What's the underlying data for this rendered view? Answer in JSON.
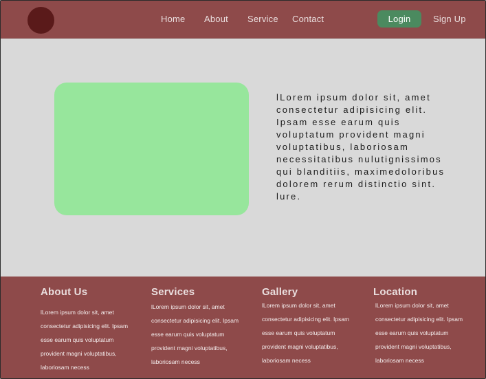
{
  "nav": {
    "home": "Home",
    "about": "About",
    "service": "Service",
    "contact": "Contact",
    "login": "Login",
    "signup": "Sign Up"
  },
  "hero": {
    "text": "lLorem ipsum dolor sit, amet consectetur adipisicing elit. Ipsam esse earum quis voluptatum provident magni voluptatibus, laboriosam necessitatibus nulutignissimos qui blanditiis, maximedoloribus dolorem rerum distinctio sint. lure."
  },
  "footer": {
    "about": {
      "title": "About Us",
      "text": "lLorem ipsum dolor sit, amet consectetur adipisicing elit. Ipsam esse earum quis voluptatum provident magni voluptatibus, laboriosam necess"
    },
    "services": {
      "title": "Services",
      "text": "lLorem ipsum dolor sit, amet consectetur adipisicing elit. Ipsam esse earum quis voluptatum provident magni voluptatibus, laboriosam necess"
    },
    "gallery": {
      "title": "Gallery",
      "text": "lLorem ipsum dolor sit, amet consectetur adipisicing elit. Ipsam esse earum quis voluptatum provident magni voluptatibus, laboriosam necess"
    },
    "location": {
      "title": "Location",
      "text": "lLorem ipsum dolor sit, amet consectetur adipisicing elit. Ipsam esse earum quis voluptatum provident magni voluptatibus, laboriosam necess"
    }
  },
  "colors": {
    "header_bg": "#8e4a4a",
    "logo": "#5a1a1a",
    "login_bg": "#4b8a5f",
    "hero_box": "#97e69c",
    "page_bg": "#d9d9d9"
  }
}
